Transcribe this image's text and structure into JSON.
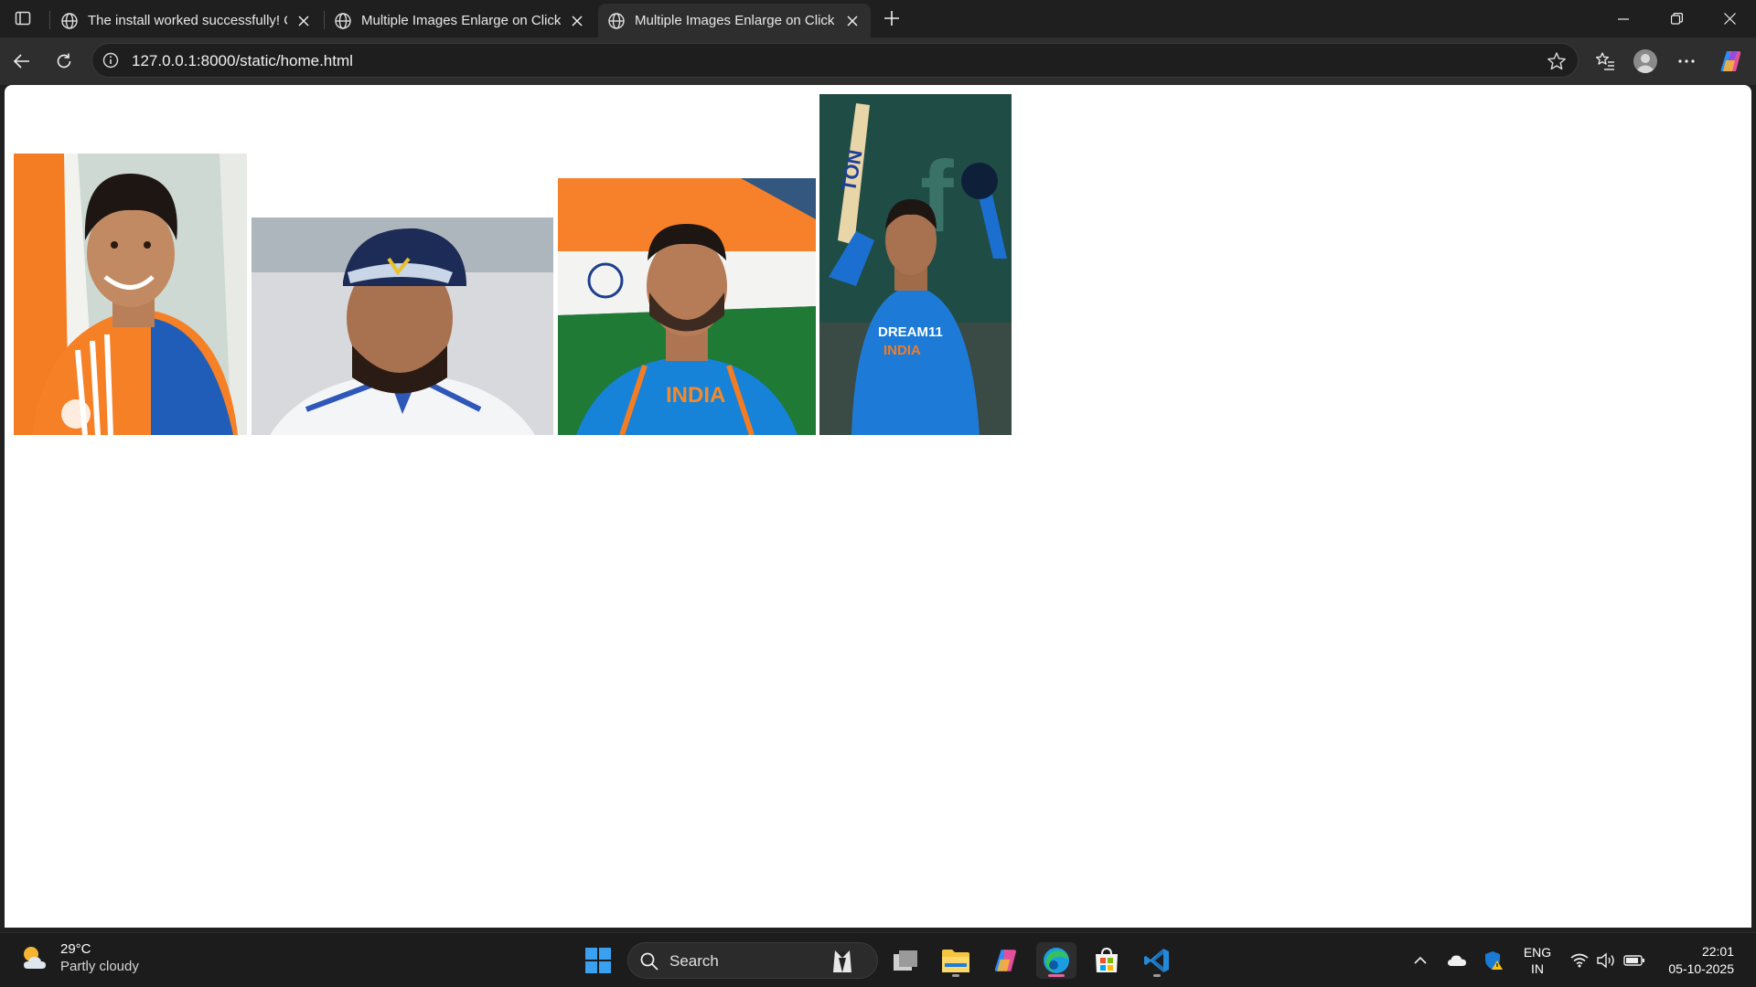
{
  "browser": {
    "tabs": [
      {
        "title": "The install worked successfully! Co",
        "active": false
      },
      {
        "title": "Multiple Images Enlarge on Click",
        "active": false
      },
      {
        "title": "Multiple Images Enlarge on Click",
        "active": true
      }
    ],
    "url": "127.0.0.1:8000/static/home.html"
  },
  "page": {
    "images": [
      {
        "name": "player-1-orange-jersey",
        "alt": ""
      },
      {
        "name": "player-2-blue-cap",
        "alt": ""
      },
      {
        "name": "player-3-india-flag",
        "alt": ""
      },
      {
        "name": "player-4-raising-bat",
        "alt": ""
      }
    ],
    "image_text": {
      "jersey_logo": "INDIA",
      "jersey_sponsor": "DREAM11",
      "jersey_country": "INDIA",
      "bat_brand": "TON"
    }
  },
  "taskbar": {
    "weather": {
      "temp": "29°C",
      "condition": "Partly cloudy"
    },
    "search_placeholder": "Search",
    "apps": [
      "windows-start",
      "search",
      "task-view",
      "file-explorer",
      "copilot",
      "edge",
      "microsoft-store",
      "vscode"
    ],
    "tray": {
      "lang": "ENG",
      "region": "IN",
      "time": "22:01",
      "date": "05-10-2025"
    }
  },
  "colors": {
    "accent": "#e0669b",
    "window_bg": "#1f1f1f",
    "toolbar_bg": "#2e2e2e"
  }
}
